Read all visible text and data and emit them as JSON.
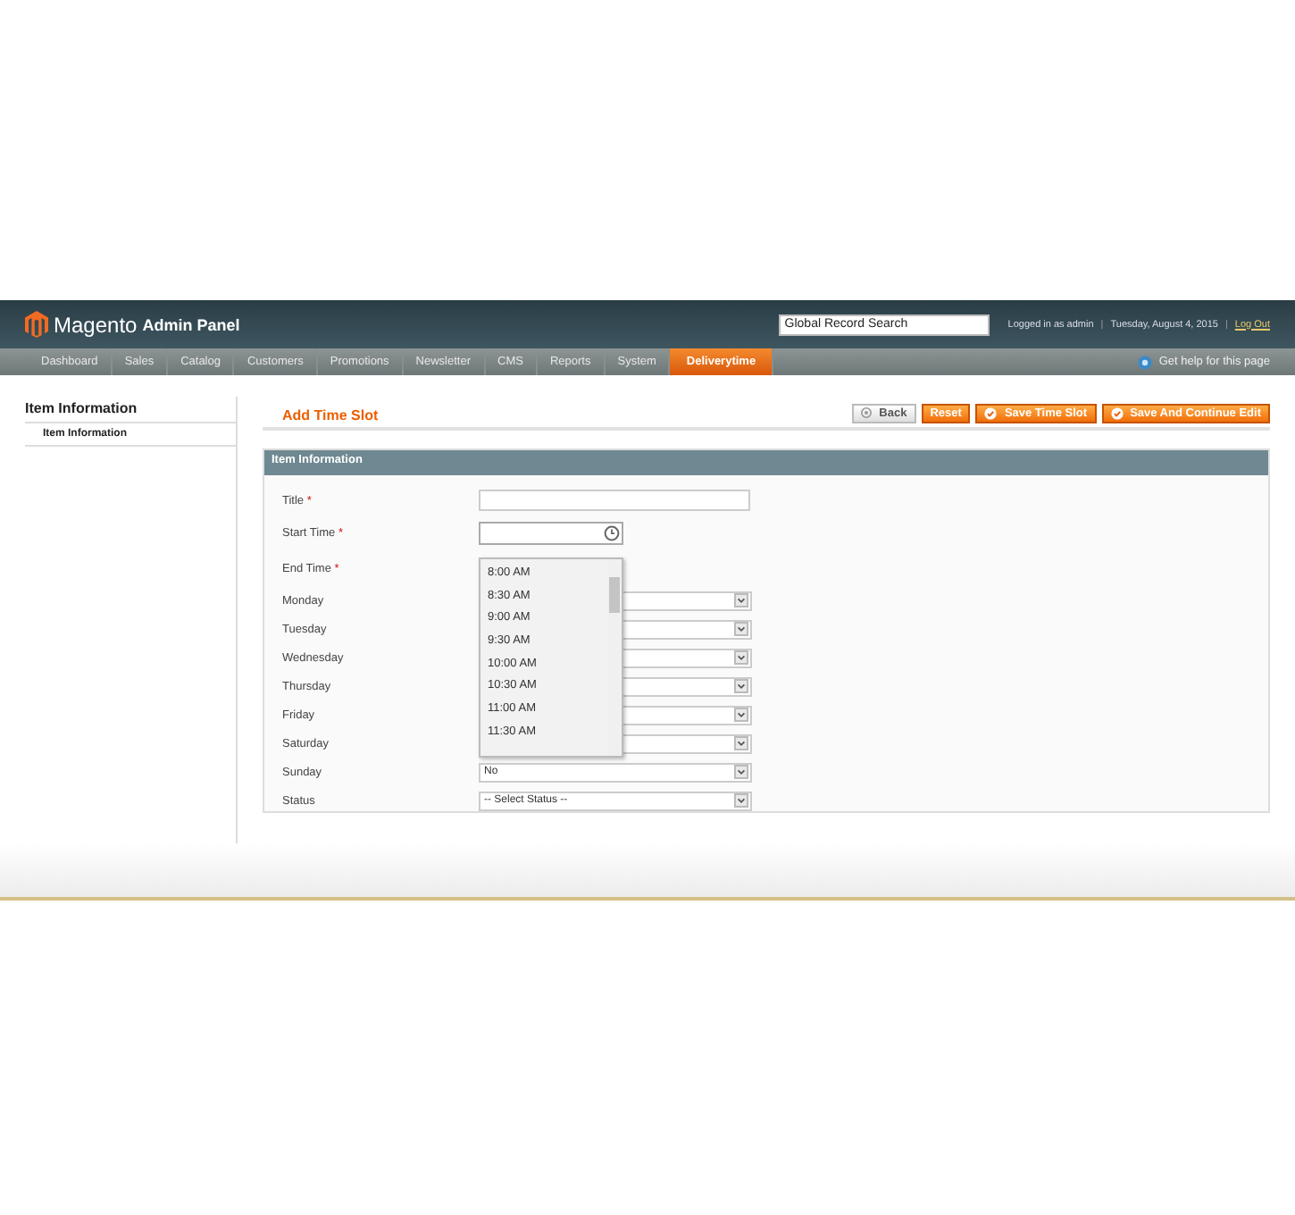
{
  "header": {
    "logo": "Magento",
    "logo_suffix": "Admin Panel",
    "search": {
      "value": "Global Record Search"
    },
    "user_info": "Logged in as admin",
    "separators": [
      "|",
      "|"
    ],
    "date": "Tuesday, August 4, 2015",
    "logout": "Log Out"
  },
  "nav": {
    "items": [
      {
        "label": "Dashboard",
        "selected": false
      },
      {
        "label": "Sales",
        "selected": false
      },
      {
        "label": "Catalog",
        "selected": false
      },
      {
        "label": "Customers",
        "selected": false
      },
      {
        "label": "Promotions",
        "selected": false
      },
      {
        "label": "Newsletter",
        "selected": false
      },
      {
        "label": "CMS",
        "selected": false
      },
      {
        "label": "Reports",
        "selected": false
      },
      {
        "label": "System",
        "selected": false
      },
      {
        "label": "Deliverytime",
        "selected": true
      }
    ],
    "help": "Get help for this page"
  },
  "sidebar": {
    "title": "Item Information",
    "items": [
      {
        "label": "Item Information"
      }
    ]
  },
  "page": {
    "title": "Add Time Slot",
    "buttons": [
      {
        "label": "Back",
        "kind": "back"
      },
      {
        "label": "Reset",
        "kind": "plain"
      },
      {
        "label": "Save Time Slot",
        "kind": "save"
      },
      {
        "label": "Save And Continue Edit",
        "kind": "save"
      }
    ]
  },
  "section": {
    "title": "Item Information",
    "fields": [
      {
        "label": "Title",
        "required_mark": "*",
        "kind": "text"
      },
      {
        "label": "Start Time",
        "required_mark": "*",
        "kind": "time"
      },
      {
        "label": "End Time",
        "required_mark": "*",
        "kind": "covered"
      },
      {
        "label": "Monday",
        "kind": "select"
      },
      {
        "label": "Tuesday",
        "kind": "select"
      },
      {
        "label": "Wednesday",
        "kind": "select"
      },
      {
        "label": "Thursday",
        "kind": "select"
      },
      {
        "label": "Friday",
        "kind": "select"
      },
      {
        "label": "Saturday",
        "kind": "select"
      },
      {
        "label": "Sunday",
        "kind": "select",
        "value": "No"
      },
      {
        "label": "Status",
        "kind": "select",
        "value": "-- Select Status --"
      }
    ],
    "time_dropdown": {
      "options": [
        "8:00 AM",
        "8:30 AM",
        "9:00 AM",
        "9:30 AM",
        "10:00 AM",
        "10:30 AM",
        "11:00 AM",
        "11:30 AM"
      ]
    }
  }
}
